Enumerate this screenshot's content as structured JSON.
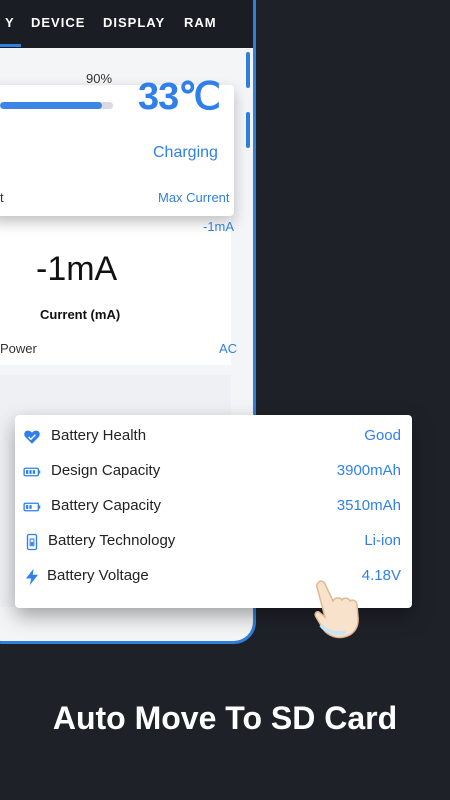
{
  "tabs": [
    {
      "label": "Y"
    },
    {
      "label": "DEVICE"
    },
    {
      "label": "DISPLAY"
    },
    {
      "label": "RAM"
    }
  ],
  "battery_card": {
    "level_text": "90%",
    "level_fraction": 0.9,
    "temperature": "33℃",
    "status": "Charging"
  },
  "current_panel": {
    "left_label": "t",
    "right_label": "Max Current",
    "max_value": "-1mA",
    "current_value": "-1mA",
    "current_label": "Current (mA)",
    "power_label": "Power",
    "power_value": "AC"
  },
  "battery_info": [
    {
      "icon": "heart-icon",
      "label": "Battery Health",
      "value": "Good"
    },
    {
      "icon": "battery-full-icon",
      "label": "Design Capacity",
      "value": "3900mAh"
    },
    {
      "icon": "battery-half-icon",
      "label": "Battery Capacity",
      "value": "3510mAh"
    },
    {
      "icon": "phone-battery-icon",
      "label": "Battery Technology",
      "value": "Li-ion"
    },
    {
      "icon": "lightning-icon",
      "label": "Battery Voltage",
      "value": "4.18V"
    }
  ],
  "caption": "Auto Move To SD Card",
  "colors": {
    "accent": "#2f80ea",
    "background": "#1f2129"
  }
}
